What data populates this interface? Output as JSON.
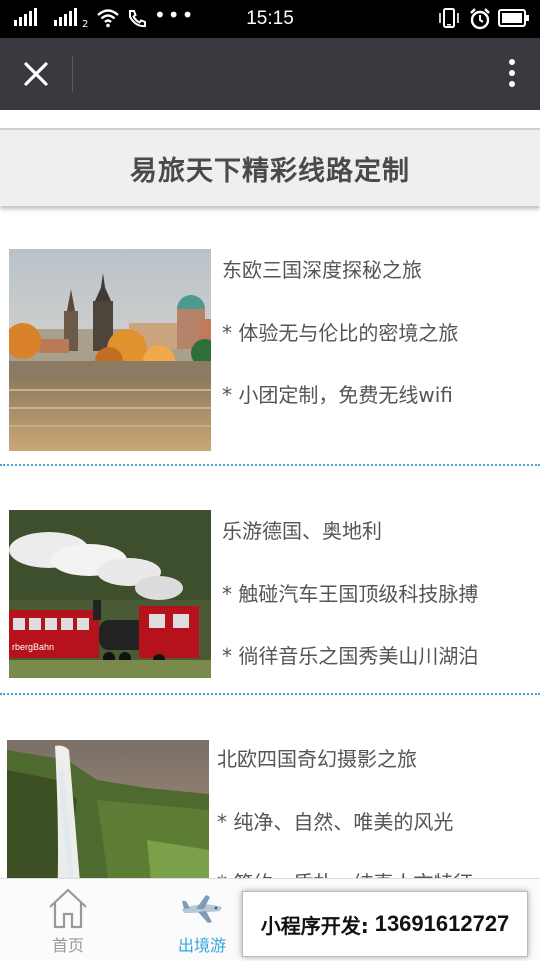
{
  "status_bar": {
    "time": "15:15",
    "net_badge": "2"
  },
  "nav": {},
  "banner": {
    "title": "易旅天下精彩线路定制"
  },
  "routes": [
    {
      "title": "东欧三国深度探秘之旅",
      "features": [
        "* 体验无与伦比的密境之旅",
        "* 小团定制，免费无线wifi"
      ]
    },
    {
      "title": "乐游德国、奥地利",
      "features": [
        "* 触碰汽车王国顶级科技脉搏",
        "* 徜徉音乐之国秀美山川湖泊"
      ],
      "train_sign": "rbergBahn"
    },
    {
      "title": "北欧四国奇幻摄影之旅",
      "features": [
        "* 纯净、自然、唯美的风光",
        "* 简约、质朴、纯真人文特征"
      ]
    }
  ],
  "tabs": [
    {
      "label": "首页",
      "icon": "home-icon"
    },
    {
      "label": "出境游",
      "icon": "airplane-icon"
    }
  ],
  "colors": {
    "accent": "#2ea8e0",
    "nav_bg": "#393a3f",
    "separator": "#4aa3d8"
  },
  "promo": {
    "label": "小程序开发:",
    "phone": "13691612727"
  }
}
